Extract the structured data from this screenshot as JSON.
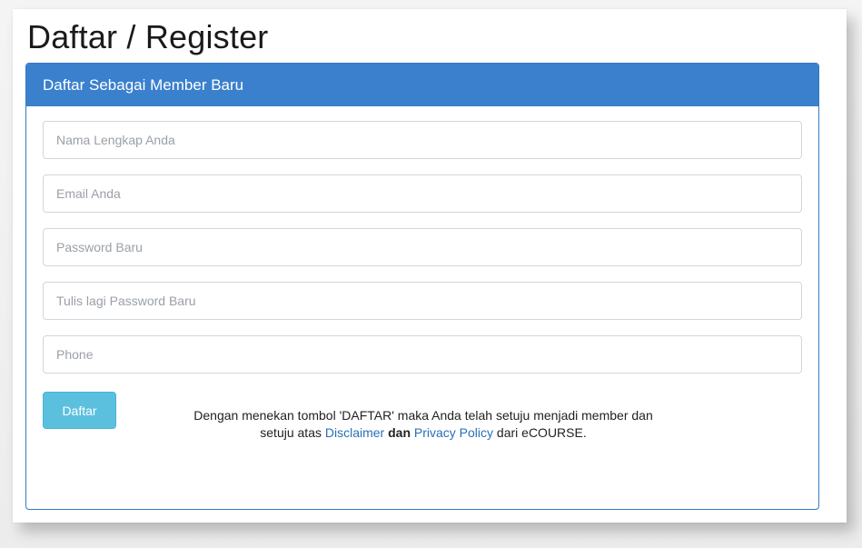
{
  "page": {
    "title": "Daftar / Register"
  },
  "panel": {
    "heading": "Daftar Sebagai Member Baru"
  },
  "form": {
    "fields": [
      {
        "name": "full-name-input",
        "type": "text",
        "placeholder": "Nama Lengkap Anda",
        "value": ""
      },
      {
        "name": "email-input",
        "type": "email",
        "placeholder": "Email Anda",
        "value": ""
      },
      {
        "name": "password-input",
        "type": "password",
        "placeholder": "Password Baru",
        "value": ""
      },
      {
        "name": "confirm-password-input",
        "type": "password",
        "placeholder": "Tulis lagi Password Baru",
        "value": ""
      },
      {
        "name": "phone-input",
        "type": "tel",
        "placeholder": "Phone",
        "value": ""
      }
    ],
    "submit_label": "Daftar"
  },
  "terms": {
    "text_before": "Dengan menekan tombol 'DAFTAR' maka Anda telah setuju menjadi member dan",
    "text_setuju": "setuju atas",
    "disclaimer_link": "Disclaimer",
    "and_word": "dan",
    "privacy_link": "Privacy Policy",
    "text_after": "dari eCOURSE."
  },
  "colors": {
    "panel_heading": "#3a80cc",
    "button": "#5bc0de",
    "link": "#2a6fba"
  }
}
